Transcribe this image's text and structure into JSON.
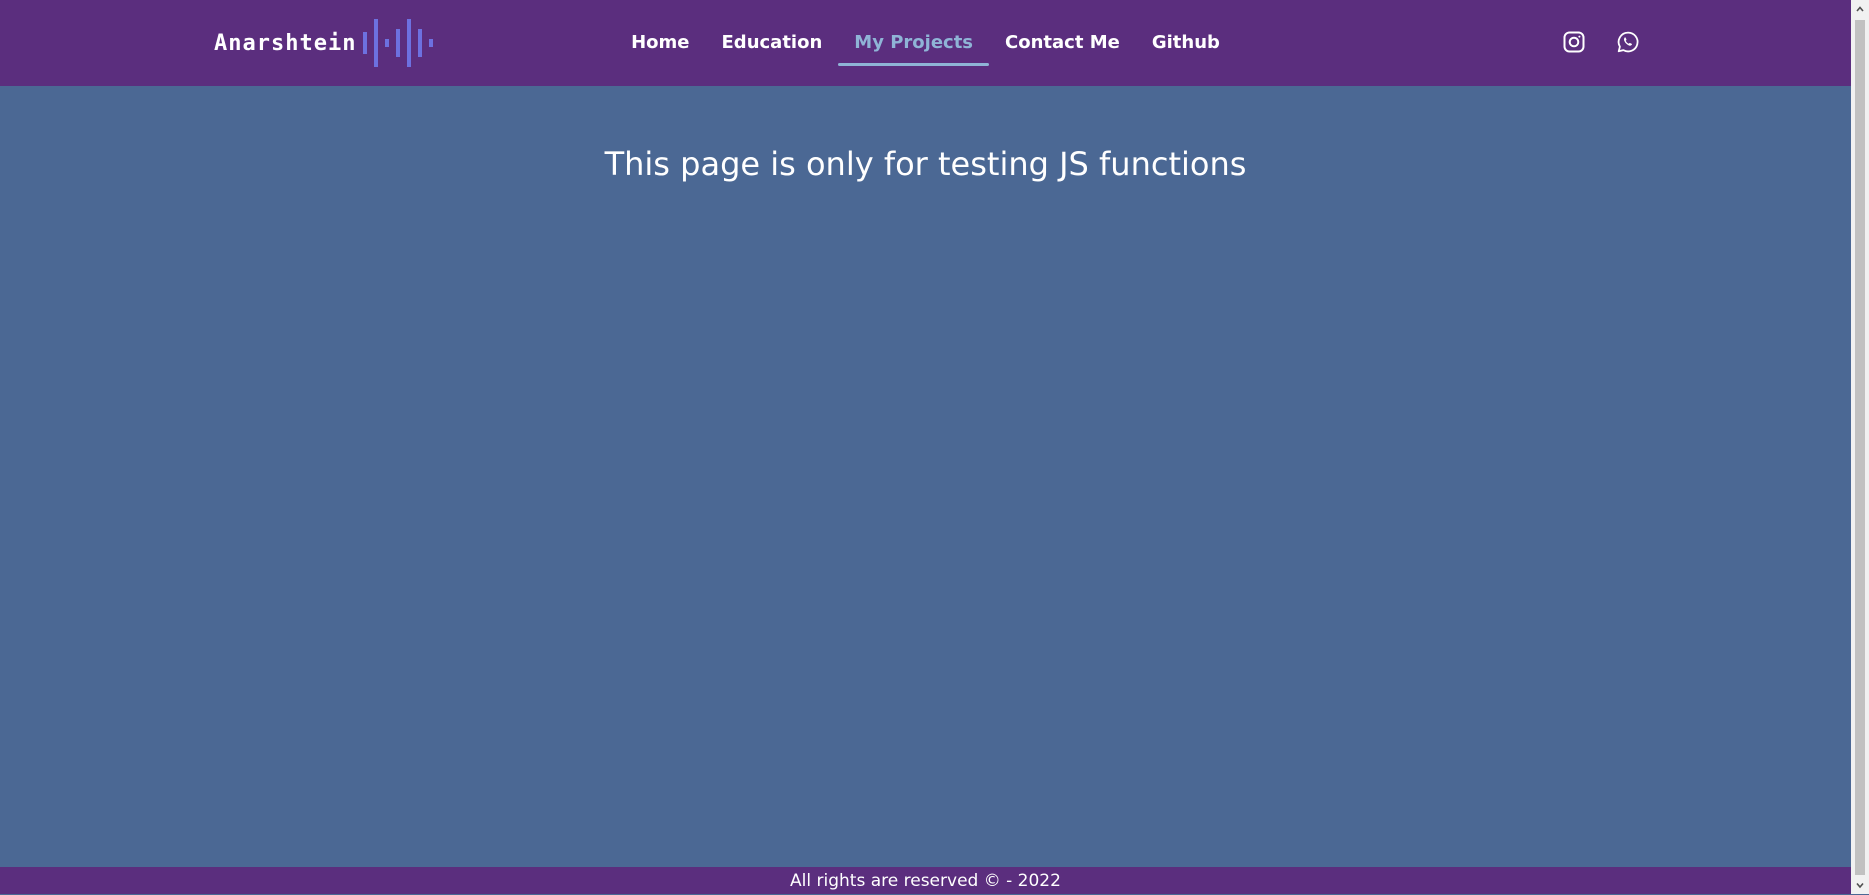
{
  "navbar": {
    "brand": "Anarshtein",
    "links": [
      "Home",
      "Education",
      "My Projects",
      "Contact Me",
      "Github"
    ],
    "active_link": "My Projects",
    "social_icons": [
      "instagram-icon",
      "whatsapp-icon"
    ]
  },
  "main": {
    "title": "This page is only for testing JS functions"
  },
  "footer": {
    "text": "All rights are reserved © - 2022"
  },
  "colors": {
    "navbar_bg": "#5b2e7e",
    "page_bg": "#4b6894",
    "active_link": "#8fb4d6",
    "brand_wave": "#6d71e0",
    "text": "#ffffff"
  }
}
